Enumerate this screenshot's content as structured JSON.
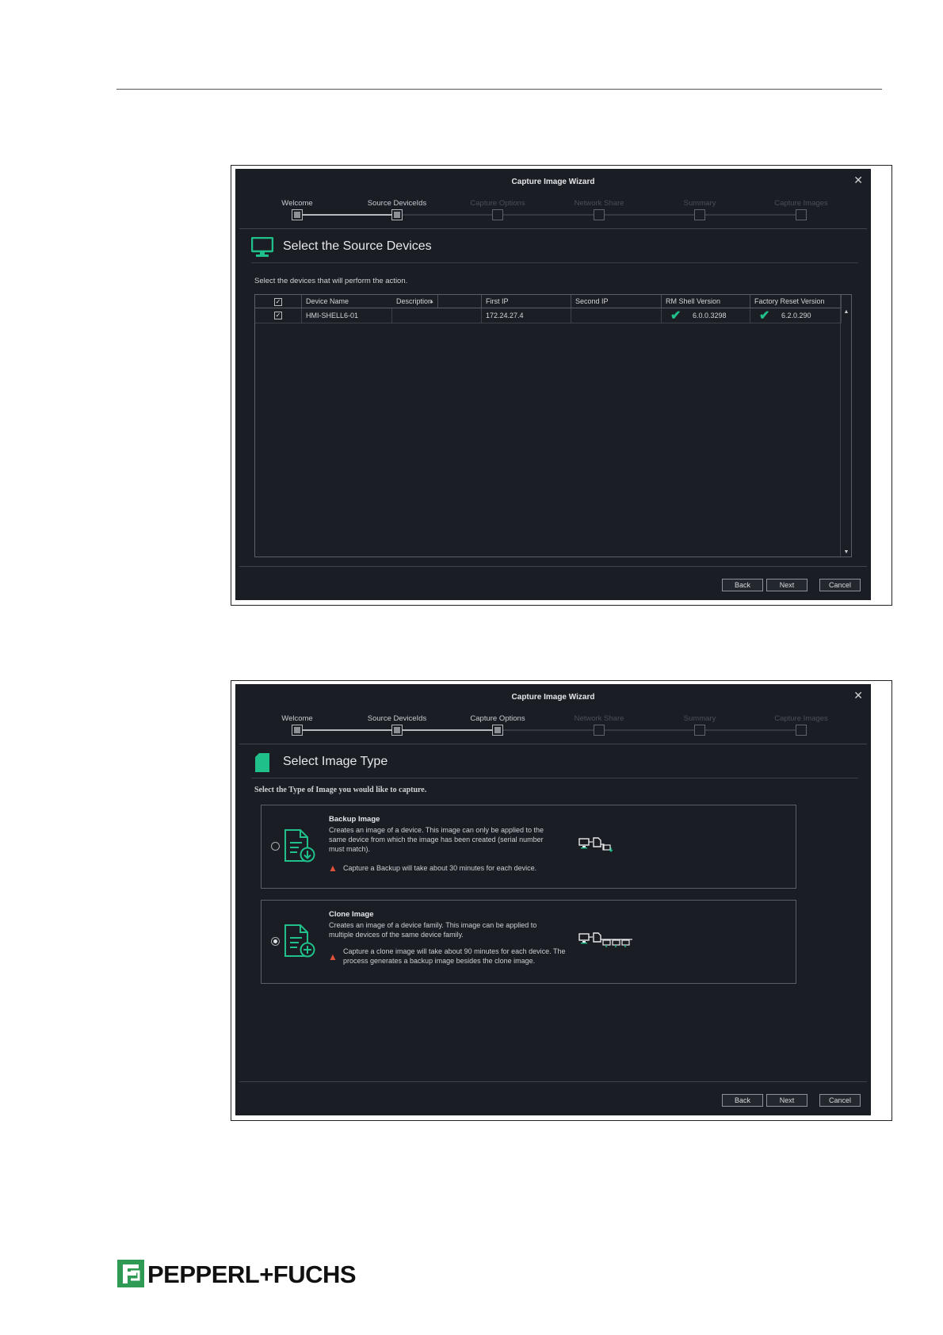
{
  "wizard_title": "Capture Image Wizard",
  "close_glyph": "✕",
  "steps": [
    "Welcome",
    "Source DeviceIds",
    "Capture Options",
    "Network Share",
    "Summary",
    "Capture Images"
  ],
  "buttons": {
    "back": "Back",
    "next": "Next",
    "cancel": "Cancel"
  },
  "screen1": {
    "page_title": "Select the Source Devices",
    "icon": "monitor-icon",
    "instruction": "Select the devices that will perform the action.",
    "columns": [
      "Device Name",
      "Description",
      "First IP",
      "Second IP",
      "RM Shell Version",
      "Factory Reset Version"
    ],
    "rows": [
      {
        "checked": true,
        "device_name": "HMI-SHELL6-01",
        "description": "",
        "first_ip": "172.24.27.4",
        "second_ip": "",
        "rm_shell_version": "6.0.0.3298",
        "factory_reset_version": "6.2.0.290"
      }
    ]
  },
  "screen2": {
    "page_title": "Select Image Type",
    "icon": "document-icon",
    "instruction": "Select the Type of Image you would like to capture.",
    "options": [
      {
        "title": "Backup Image",
        "description": "Creates an image of a device. This image can only be applied to the same device from which the image has been created (serial number must match).",
        "warning": "Capture a Backup will take about 30 minutes for each device.",
        "selected": false
      },
      {
        "title": "Clone Image",
        "description": "Creates an image of a device family. This image can be applied to multiple devices of the same device family.",
        "warning": "Capture a clone image will take about 90 minutes for each device. The process generates a backup image besides the clone image.",
        "selected": true
      }
    ]
  },
  "logo_text": "PEPPERL+FUCHS",
  "colors": {
    "accent": "#1fc08a",
    "background": "#1a1d24",
    "warning": "#e0513c",
    "logo_green": "#2e9a54"
  }
}
